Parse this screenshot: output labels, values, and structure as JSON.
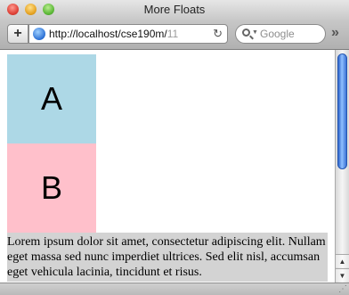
{
  "window": {
    "title": "More Floats"
  },
  "toolbar": {
    "add_label": "+",
    "url": "http://localhost/cse190m/",
    "url_dim": "11",
    "search_placeholder": "Google",
    "overflow_label": "»"
  },
  "content": {
    "box_a": "A",
    "box_b": "B",
    "paragraph": "Lorem ipsum dolor sit amet, consectetur adipiscing elit. Nullam eget massa sed nunc imperdiet ultrices. Sed elit nisl, accumsan eget vehicula lacinia, tincidunt et risus."
  },
  "colors": {
    "box_a": "#add8e6",
    "box_b": "#ffc0cb",
    "paragraph_bg": "#d3d3d3"
  }
}
